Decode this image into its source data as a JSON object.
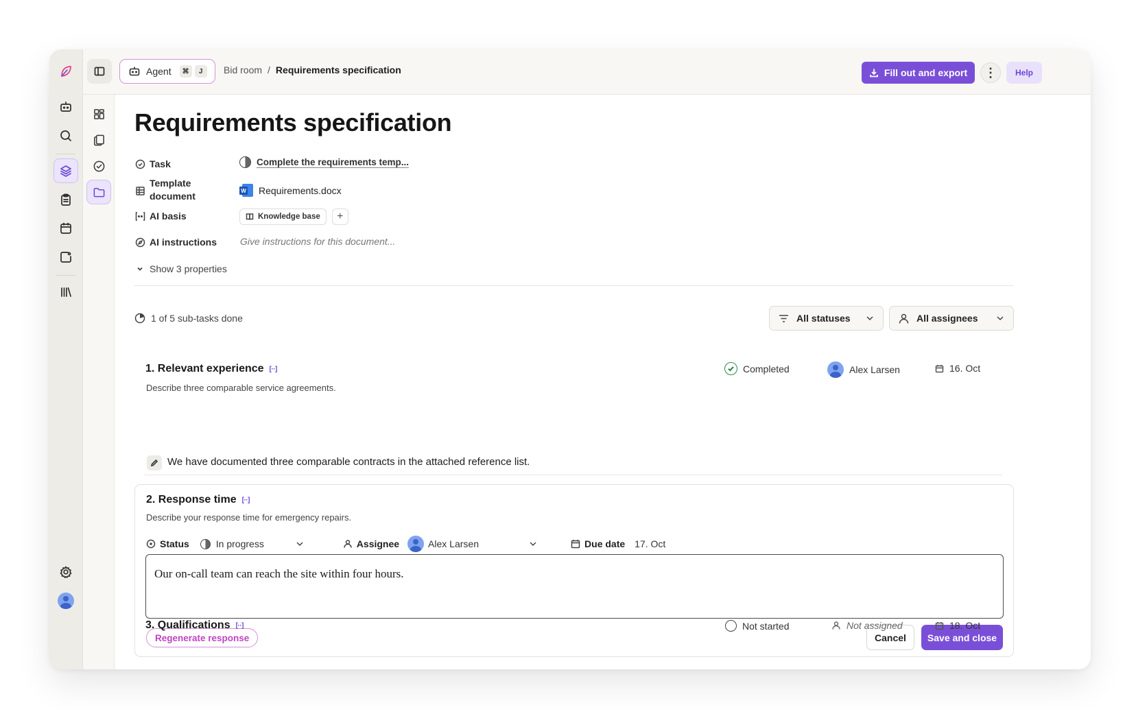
{
  "topbar": {
    "agent_label": "Agent",
    "agent_shortcut_mod": "⌘",
    "agent_shortcut_key": "J",
    "breadcrumb_parent": "Bid room",
    "breadcrumb_sep": "/",
    "breadcrumb_current": "Requirements specification",
    "export_label": "Fill out and export",
    "more_label": "⋮",
    "help_label": "Help"
  },
  "rail": {
    "items": [
      "logo-icon",
      "robot-icon",
      "search-icon",
      "layers-icon",
      "clipboard-icon",
      "calendar-icon",
      "tasks-icon",
      "library-icon",
      "settings-icon",
      "avatar"
    ],
    "active": "layers-icon"
  },
  "subnav": {
    "items": [
      "dashboard-icon",
      "documents-icon",
      "check-circle-icon",
      "folder-icon"
    ],
    "active": "folder-icon"
  },
  "page": {
    "title": "Requirements specification",
    "properties": {
      "task_label": "Task",
      "task_value": "Complete the requirements temp...",
      "template_label_1": "Template",
      "template_label_2": "document",
      "template_value": "Requirements.docx",
      "ai_basis_label": "AI basis",
      "ai_basis_chip": "Knowledge base",
      "ai_basis_add": "+",
      "ai_instructions_label": "AI instructions",
      "ai_instructions_placeholder": "Give instructions for this document...",
      "show_more": "Show 3 properties"
    },
    "progress": "1 of 5 sub-tasks done",
    "filters": {
      "status": "All statuses",
      "assignee": "All assignees"
    }
  },
  "requirements": [
    {
      "title": "1. Relevant experience",
      "ai_mark": "[··]",
      "description": "Describe three comparable service agreements.",
      "status": "Completed",
      "assignee": "Alex Larsen",
      "due": "16. Oct",
      "answer": "We have documented three comparable contracts in the attached reference list."
    },
    {
      "title": "2. Response time",
      "ai_mark": "[··]",
      "description": "Describe your response time for emergency repairs.",
      "status_label": "Status",
      "status": "In progress",
      "assignee_label": "Assignee",
      "assignee": "Alex Larsen",
      "due_label": "Due date",
      "due": "17. Oct",
      "answer": "Our on-call team can reach the site within four hours.",
      "regenerate_label": "Regenerate response",
      "cancel_label": "Cancel",
      "save_label": "Save and close"
    },
    {
      "title": "3. Qualifications",
      "ai_mark": "[··]",
      "status": "Not started",
      "assignee": "Not assigned",
      "due": "18. Oct"
    }
  ],
  "colors": {
    "accent": "#7a4fd8",
    "accent_soft": "#ebe4fb",
    "pink_outline": "#d690d8",
    "completed_green": "#2b8a4b"
  }
}
